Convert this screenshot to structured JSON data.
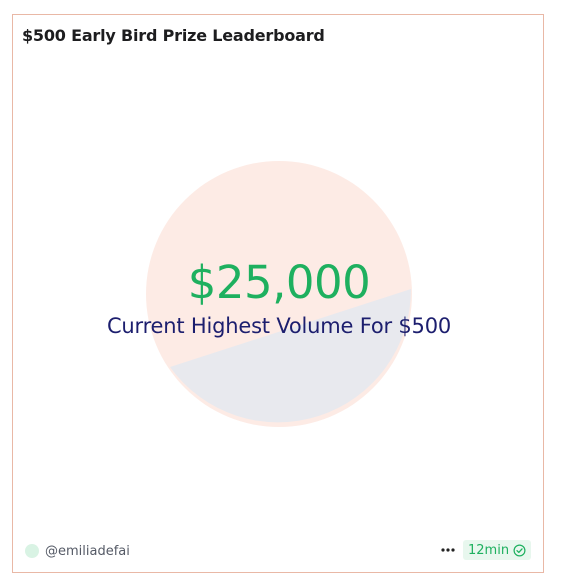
{
  "card": {
    "title": "$500 Early Bird Prize Leaderboard",
    "big_value": "$25,000",
    "subtitle": "Current Highest Volume For $500",
    "author": "@emiliadefai",
    "time": "12min",
    "more_icon": "more-horizontal-icon",
    "verified_icon": "check-circle-icon"
  },
  "colors": {
    "value_green": "#1eb05f",
    "subtitle_navy": "#1c1e6e",
    "pie_peach": "#fdebe5",
    "pie_gray": "#e8e9ee",
    "card_border": "#e9b8a6"
  }
}
